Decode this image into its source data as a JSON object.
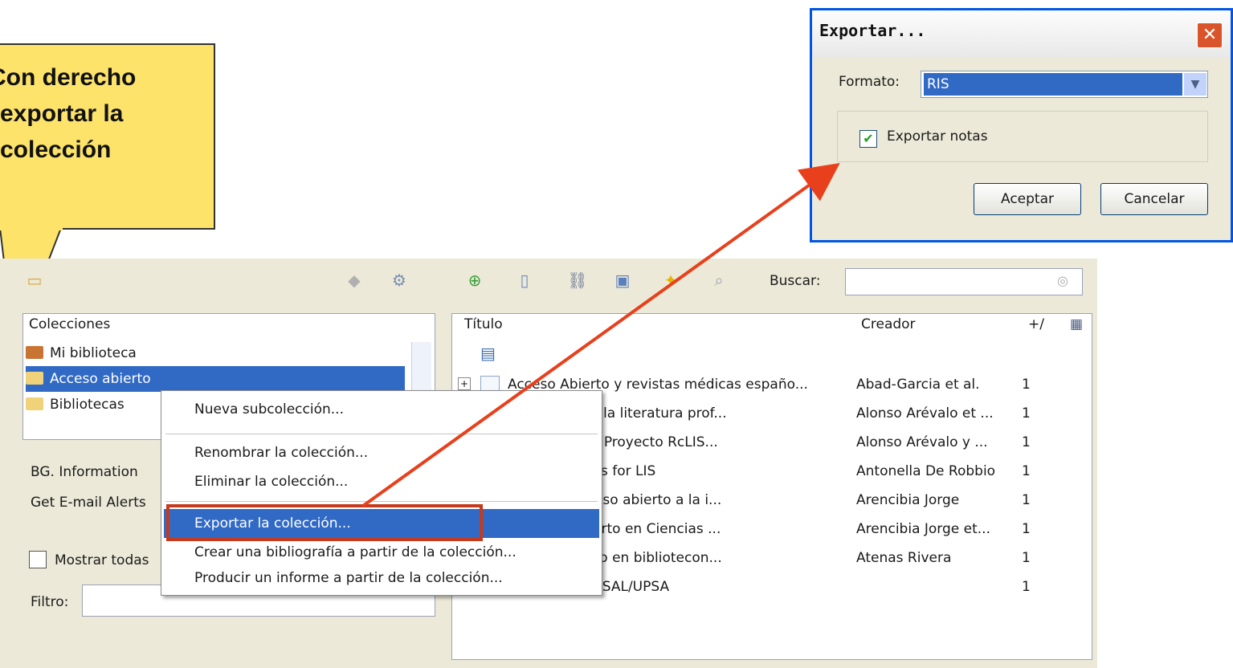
{
  "callout": {
    "text": "Con derecho\nexportar la\ncolección"
  },
  "toolbar": {
    "buscar_label": "Buscar:",
    "search_value": ""
  },
  "collections": {
    "header": "Colecciones",
    "items": [
      {
        "label": "Mi biblioteca",
        "icon": "library-icon",
        "selected": false
      },
      {
        "label": "Acceso abierto",
        "icon": "folder-icon",
        "selected": true
      },
      {
        "label": "Bibliotecas",
        "icon": "folder-icon",
        "selected": false
      }
    ]
  },
  "tags": {
    "items": [
      "BG. Information",
      "Get E-mail Alerts"
    ],
    "show_all_label": "Mostrar todas",
    "filter_label": "Filtro:",
    "filter_value": ""
  },
  "items_table": {
    "columns": {
      "title": "Título",
      "creator": "Creador",
      "count": "+/"
    },
    "rows": [
      {
        "title": "Acceso Abierto y revistas médicas españo...",
        "creator": "Abad-Garcia et al.",
        "count": "1"
      },
      {
        "title": "usabilidad de la literatura prof...",
        "creator": "Alonso Arévalo et ...",
        "count": "1"
      },
      {
        "title": "Open Access. Proyecto RcLIS...",
        "creator": "Alonso Arévalo y ...",
        "count": "1"
      },
      {
        "title": "ome to Eprints for LIS",
        "creator": "Antonella De Robbio",
        "count": "1"
      },
      {
        "title": "s para el acceso abierto a la i...",
        "creator": "Arencibia Jorge",
        "count": "1"
      },
      {
        "title": "e acceso abierto en Ciencias ...",
        "creator": "Arencibia Jorge et...",
        "count": "1"
      },
      {
        "title": "acceso abierto en bibliotecon...",
        "creator": "Atenas Rivera",
        "count": "1"
      },
      {
        "title": "SAL / UPSA /USAL/UPSA",
        "creator": "",
        "count": "1"
      }
    ]
  },
  "context_menu": {
    "items": [
      "Nueva subcolección...",
      "Renombrar la colección...",
      "Eliminar la colección...",
      "Exportar la colección...",
      "Crear una bibliografía a partir de la colección...",
      "Producir un informe a partir de la colección..."
    ]
  },
  "export_dialog": {
    "title": "Exportar...",
    "formato_label": "Formato:",
    "formato_value": "RIS",
    "notas_label": "Exportar notas",
    "notas_checked": true,
    "accept_label": "Aceptar",
    "cancel_label": "Cancelar"
  },
  "colors": {
    "callout_bg": "#fde36a",
    "selection": "#316ac5",
    "highlight_box": "#c33a1e",
    "arrow": "#e8401c"
  }
}
